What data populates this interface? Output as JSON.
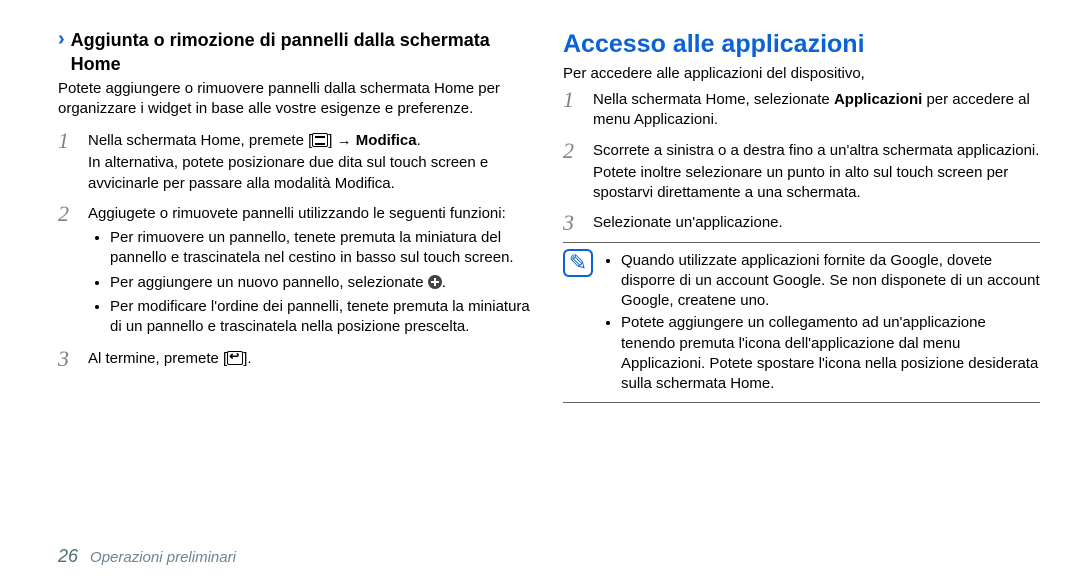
{
  "left": {
    "subhead": "Aggiunta o rimozione di pannelli dalla schermata Home",
    "intro": "Potete aggiungere o rimuovere pannelli dalla schermata Home per organizzare i widget in base alle vostre esigenze e preferenze.",
    "step1_a": "Nella schermata Home, premete [",
    "step1_b": "] → ",
    "step1_c": "Modifica",
    "step1_d": ".",
    "step1_alt": "In alternativa, potete posizionare due dita sul touch screen e avvicinarle per passare alla modalità Modifica.",
    "step2": "Aggiugete o rimuovete pannelli utilizzando le seguenti funzioni:",
    "step2_b1": "Per rimuovere un pannello, tenete premuta la miniatura del pannello e trascinatela nel cestino in basso sul touch screen.",
    "step2_b2a": "Per aggiungere un nuovo pannello, selezionate ",
    "step2_b2b": ".",
    "step2_b3": "Per modificare l'ordine dei pannelli, tenete premuta la miniatura di un pannello e trascinatela nella posizione prescelta.",
    "step3_a": "Al termine, premete [",
    "step3_b": "]."
  },
  "right": {
    "title": "Accesso alle applicazioni",
    "intro": "Per accedere alle applicazioni del dispositivo,",
    "step1_a": "Nella schermata Home, selezionate ",
    "step1_b": "Applicazioni",
    "step1_c": " per accedere al menu Applicazioni.",
    "step2": "Scorrete a sinistra o a destra fino a un'altra schermata applicazioni.",
    "step2_p": "Potete inoltre selezionare un punto in alto sul touch screen per spostarvi direttamente a una schermata.",
    "step3": "Selezionate un'applicazione.",
    "note1": "Quando utilizzate applicazioni fornite da Google, dovete disporre di un account Google. Se non disponete di un account Google, createne uno.",
    "note2": "Potete aggiungere un collegamento ad un'applicazione tenendo premuta l'icona dell'applicazione dal menu Applicazioni. Potete spostare l'icona nella posizione desiderata sulla schermata Home."
  },
  "footer": {
    "page": "26",
    "section": "Operazioni preliminari"
  }
}
